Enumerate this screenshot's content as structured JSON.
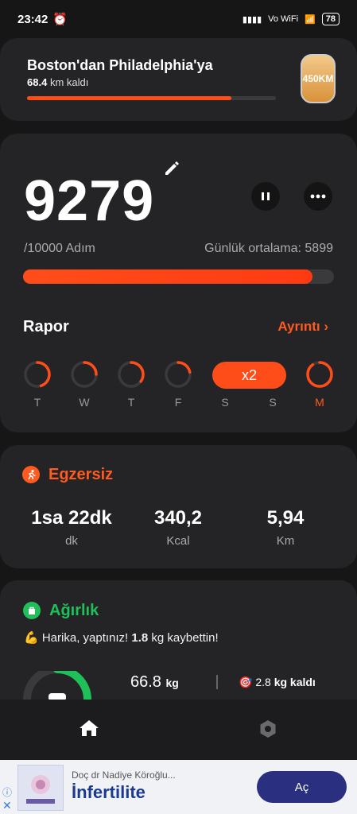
{
  "status_bar": {
    "time": "23:42",
    "net": "Vo WiFi",
    "battery": "78"
  },
  "route": {
    "title": "Boston'dan Philadelphia'ya",
    "remaining_value": "68.4",
    "remaining_unit": "km kaldı",
    "progress_pct": 82,
    "badge": "450KM"
  },
  "steps": {
    "count": "9279",
    "goal": "/10000 Adım",
    "average": "Günlük ortalama: 5899",
    "progress_pct": 93
  },
  "report": {
    "title": "Rapor",
    "detail_link": "Ayrıntı",
    "days": [
      {
        "label": "T",
        "fill": 0.45
      },
      {
        "label": "W",
        "fill": 0.25
      },
      {
        "label": "T",
        "fill": 0.35
      },
      {
        "label": "F",
        "fill": 0.22
      },
      {
        "label": "S",
        "fill": 1.0
      },
      {
        "label": "S",
        "fill": 1.0
      },
      {
        "label": "M",
        "fill": 0.9
      }
    ],
    "streak_label": "x2"
  },
  "exercise": {
    "title": "Egzersiz",
    "metrics": [
      {
        "value": "1sa 22dk",
        "unit": "dk"
      },
      {
        "value": "340,2",
        "unit": "Kcal"
      },
      {
        "value": "5,94",
        "unit": "Km"
      }
    ]
  },
  "weight": {
    "title": "Ağırlık",
    "praise_prefix": "💪 Harika, yaptınız! ",
    "praise_value": "1.8",
    "praise_suffix": " kg kaybettin!",
    "current_value": "66.8",
    "current_unit": "kg",
    "remaining_value": "2.8",
    "remaining_unit": "kg kaldı"
  },
  "ad": {
    "sponsor": "Doç dr Nadiye Köroğlu...",
    "title": "İnfertilite",
    "button": "Aç"
  },
  "colors": {
    "accent": "#ff4d1a",
    "green": "#1fbf5a",
    "card": "#242426"
  }
}
